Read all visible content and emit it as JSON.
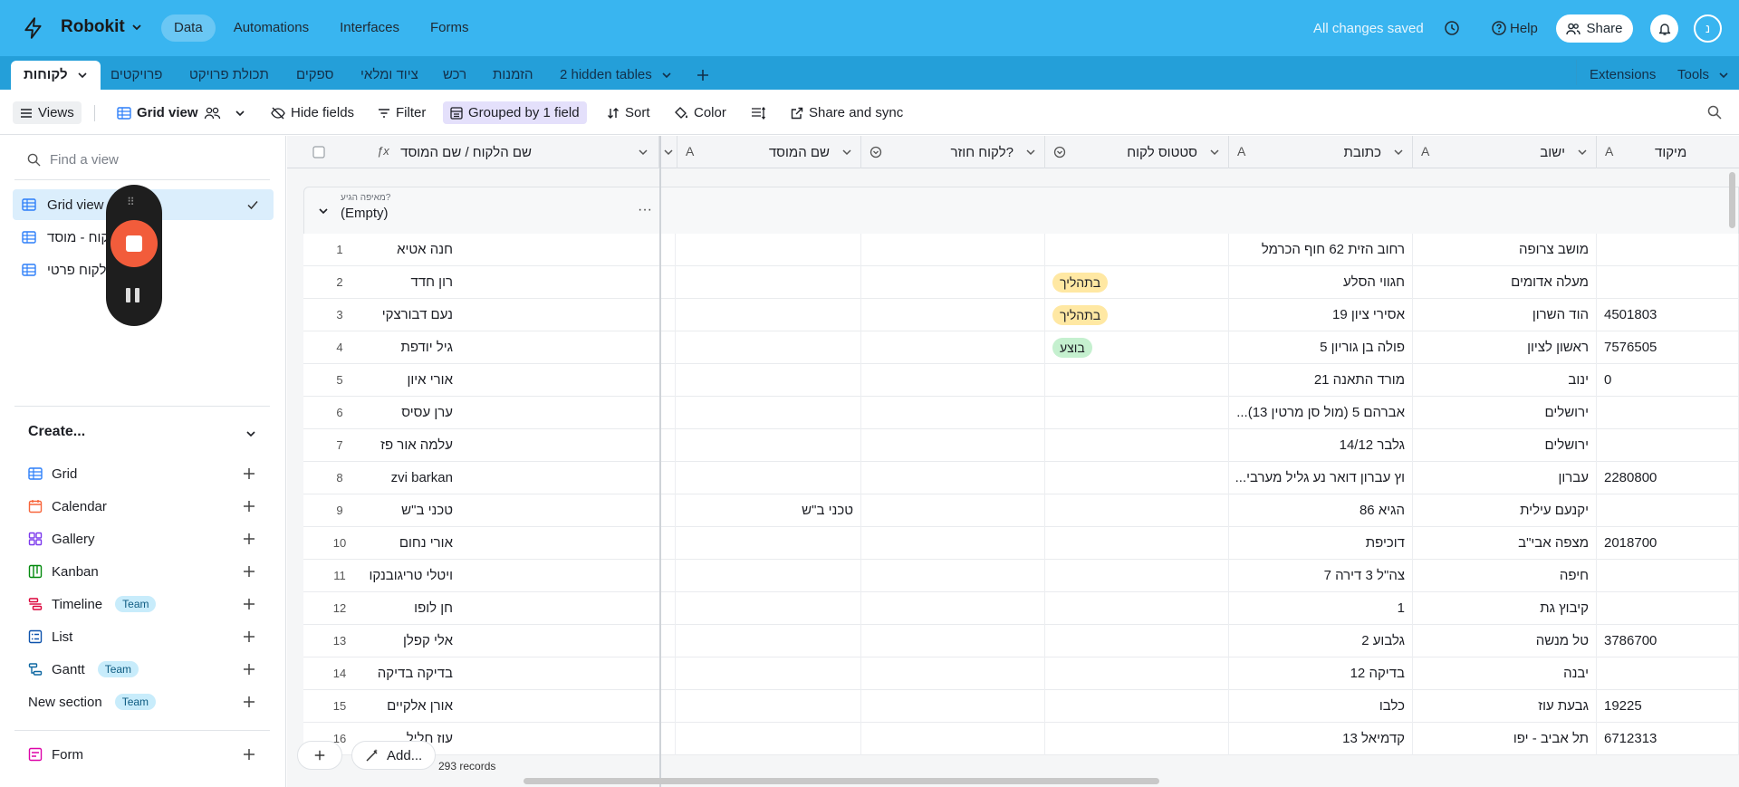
{
  "app": {
    "name": "Robokit"
  },
  "topnav": [
    {
      "label": "Data",
      "active": true
    },
    {
      "label": "Automations",
      "active": false
    },
    {
      "label": "Interfaces",
      "active": false
    },
    {
      "label": "Forms",
      "active": false
    }
  ],
  "topbar": {
    "saved": "All changes saved",
    "help": "Help",
    "share": "Share",
    "avatar_initial": "נ"
  },
  "tabs": {
    "active": "לקוחות",
    "items": [
      "פרויקטים",
      "תכולת פרויקט",
      "ספקים",
      "ציוד ומלאי",
      "רכש",
      "הזמנות"
    ],
    "hidden": "2 hidden tables",
    "extensions": "Extensions",
    "tools": "Tools"
  },
  "toolbar": {
    "views": "Views",
    "view_name": "Grid view",
    "hide_fields": "Hide fields",
    "filter": "Filter",
    "grouped": "Grouped by 1 field",
    "sort": "Sort",
    "color": "Color",
    "share_sync": "Share and sync"
  },
  "sidebar": {
    "find_placeholder": "Find a view",
    "views": [
      "Grid view",
      "לקוח - מוסד",
      "לקוח פרטי"
    ],
    "create_label": "Create...",
    "create_items": [
      {
        "label": "Grid",
        "icon": "grid-icon",
        "color": "#2d7ff9"
      },
      {
        "label": "Calendar",
        "icon": "calendar-icon",
        "color": "#f7653b"
      },
      {
        "label": "Gallery",
        "icon": "gallery-icon",
        "color": "#7c39ed"
      },
      {
        "label": "Kanban",
        "icon": "kanban-icon",
        "color": "#048a0e"
      },
      {
        "label": "Timeline",
        "icon": "timeline-icon",
        "color": "#dc043b",
        "badge": "Team"
      },
      {
        "label": "List",
        "icon": "list-icon",
        "color": "#0d52ac"
      },
      {
        "label": "Gantt",
        "icon": "gantt-icon",
        "color": "#0f68a2",
        "badge": "Team"
      }
    ],
    "new_section": "New section",
    "new_section_badge": "Team",
    "form": "Form",
    "form_color": "#dd04a8"
  },
  "columns": [
    "שם הלקוח / שם המוסד",
    "שם המוסד",
    "לקוח חוזר?",
    "סטטוס לקוח",
    "כתובת",
    "ישוב",
    "מיקוד"
  ],
  "group": {
    "field_label": "מאיפה הגיע?",
    "value": "(Empty)"
  },
  "rows": [
    {
      "n": "1",
      "name": "חנה אטיא",
      "inst": "",
      "ret": "",
      "status": "",
      "sc": "",
      "addr": "רחוב הזית 62 חוף הכרמל",
      "city": "מושב צרופה",
      "zip": ""
    },
    {
      "n": "2",
      "name": "רון חדד",
      "inst": "",
      "ret": "",
      "status": "בתהליך",
      "sc": "yellow",
      "addr": "חגווי הסלע",
      "city": "מעלה אדומים",
      "zip": ""
    },
    {
      "n": "3",
      "name": "נעם דבורצקי",
      "inst": "",
      "ret": "",
      "status": "בתהליך",
      "sc": "yellow",
      "addr": "אסירי ציון 19",
      "city": "הוד השרון",
      "zip": "4501803"
    },
    {
      "n": "4",
      "name": "גיל יודפת",
      "inst": "",
      "ret": "",
      "status": "בוצע",
      "sc": "green",
      "addr": "פולה בן גוריון 5",
      "city": "ראשון לציון",
      "zip": "7576505"
    },
    {
      "n": "5",
      "name": "אורי איון",
      "inst": "",
      "ret": "",
      "status": "",
      "sc": "",
      "addr": "מורד התאנה 21",
      "city": "ינוב",
      "zip": "0"
    },
    {
      "n": "6",
      "name": "ערן עסיס",
      "inst": "",
      "ret": "",
      "status": "",
      "sc": "",
      "addr": "...אברהם 5 (מול סן מרטין 13)",
      "city": "ירושלים",
      "zip": ""
    },
    {
      "n": "7",
      "name": "עלמה אור פז",
      "inst": "",
      "ret": "",
      "status": "",
      "sc": "",
      "addr": "גלבר 14/12",
      "city": "ירושלים",
      "zip": ""
    },
    {
      "n": "8",
      "name": "zvi barkan",
      "inst": "",
      "ret": "",
      "status": "",
      "sc": "",
      "addr": "...וץ עברון דואר נע גליל מערבי",
      "city": "עברון",
      "zip": "2280800"
    },
    {
      "n": "9",
      "name": "טכני ב\"ש",
      "inst": "טכני ב\"ש",
      "ret": "",
      "status": "",
      "sc": "",
      "addr": "הגיא 86",
      "city": "יקנעם עילית",
      "zip": ""
    },
    {
      "n": "10",
      "name": "אורי נחום",
      "inst": "",
      "ret": "",
      "status": "",
      "sc": "",
      "addr": "דוכיפת",
      "city": "מצפה אבי\"ב",
      "zip": "2018700"
    },
    {
      "n": "11",
      "name": "ויטלי טריגובנקו",
      "inst": "",
      "ret": "",
      "status": "",
      "sc": "",
      "addr": "צה\"ל 3 דירה 7",
      "city": "חיפה",
      "zip": ""
    },
    {
      "n": "12",
      "name": "חן לופו",
      "inst": "",
      "ret": "",
      "status": "",
      "sc": "",
      "addr": "1",
      "city": "קיבוץ גת",
      "zip": ""
    },
    {
      "n": "13",
      "name": "אלי קפלן",
      "inst": "",
      "ret": "",
      "status": "",
      "sc": "",
      "addr": "גלבוע 2",
      "city": "טל מנשה",
      "zip": "3786700"
    },
    {
      "n": "14",
      "name": "בדיקה בדיקה",
      "inst": "",
      "ret": "",
      "status": "",
      "sc": "",
      "addr": "בדיקה 12",
      "city": "יבנה",
      "zip": ""
    },
    {
      "n": "15",
      "name": "אורן אלקיים",
      "inst": "",
      "ret": "",
      "status": "",
      "sc": "",
      "addr": "כלבו",
      "city": "גבעת עוז",
      "zip": "19225"
    },
    {
      "n": "16",
      "name": "עוז חליל",
      "inst": "",
      "ret": "",
      "status": "",
      "sc": "",
      "addr": "קדמיאל 13",
      "city": "תל אביב - יפו",
      "zip": "6712313"
    }
  ],
  "footer": {
    "add": "Add...",
    "records": "293 records"
  }
}
